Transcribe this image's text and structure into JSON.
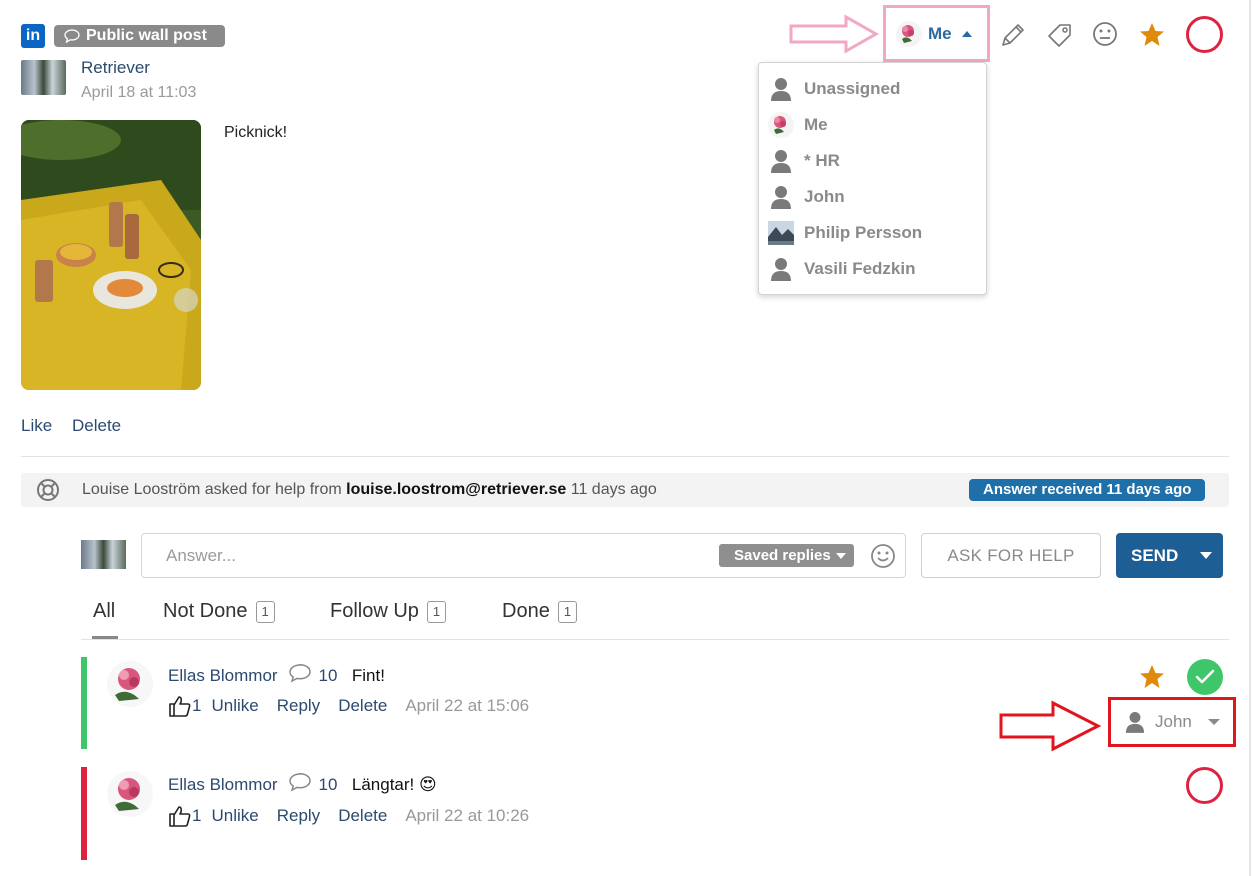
{
  "post": {
    "network_icon": "linkedin-icon",
    "type_label": "Public wall post",
    "author": "Retriever",
    "date": "April 18 at 11:03",
    "text": "Picknick!",
    "like_label": "Like",
    "delete_label": "Delete"
  },
  "toolbar": {
    "assignee_label": "Me",
    "icons": [
      "pencil-icon",
      "tag-icon",
      "smiley-icon",
      "star-icon",
      "status-circle-icon"
    ],
    "star_color": "#e08a0b",
    "status_color": "#dd2340"
  },
  "assign_dropdown": {
    "items": [
      {
        "label": "Unassigned",
        "icon": "person-icon"
      },
      {
        "label": "Me",
        "icon": "flower-avatar"
      },
      {
        "label": "* HR",
        "icon": "person-icon"
      },
      {
        "label": "John",
        "icon": "person-icon"
      },
      {
        "label": "Philip Persson",
        "icon": "landscape-avatar"
      },
      {
        "label": "Vasili Fedzkin",
        "icon": "person-icon"
      }
    ]
  },
  "help": {
    "prefix": "Louise Looström asked for help from",
    "email": "louise.loostrom@retriever.se",
    "suffix": "11 days ago",
    "badge": "Answer received 11 days ago"
  },
  "answer": {
    "placeholder": "Answer...",
    "saved_replies": "Saved replies",
    "ask_for_help": "ASK FOR HELP",
    "send": "SEND"
  },
  "tabs": [
    {
      "label": "All",
      "count": ""
    },
    {
      "label": "Not Done",
      "count": "1"
    },
    {
      "label": "Follow Up",
      "count": "1"
    },
    {
      "label": "Done",
      "count": "1"
    }
  ],
  "comments": [
    {
      "author": "Ellas Blommor",
      "comment_count": "10",
      "text": "Fint!",
      "likes": "1",
      "unlike_label": "Unlike",
      "reply_label": "Reply",
      "delete_label": "Delete",
      "time": "April 22 at 15:06",
      "status": "done",
      "bar_color": "#3fc66a",
      "assignee": "John"
    },
    {
      "author": "Ellas Blommor",
      "comment_count": "10",
      "text": "Längtar! 😍",
      "likes": "1",
      "unlike_label": "Unlike",
      "reply_label": "Reply",
      "delete_label": "Delete",
      "time": "April 22 at 10:26",
      "status": "not-done",
      "bar_color": "#dd2340"
    }
  ]
}
